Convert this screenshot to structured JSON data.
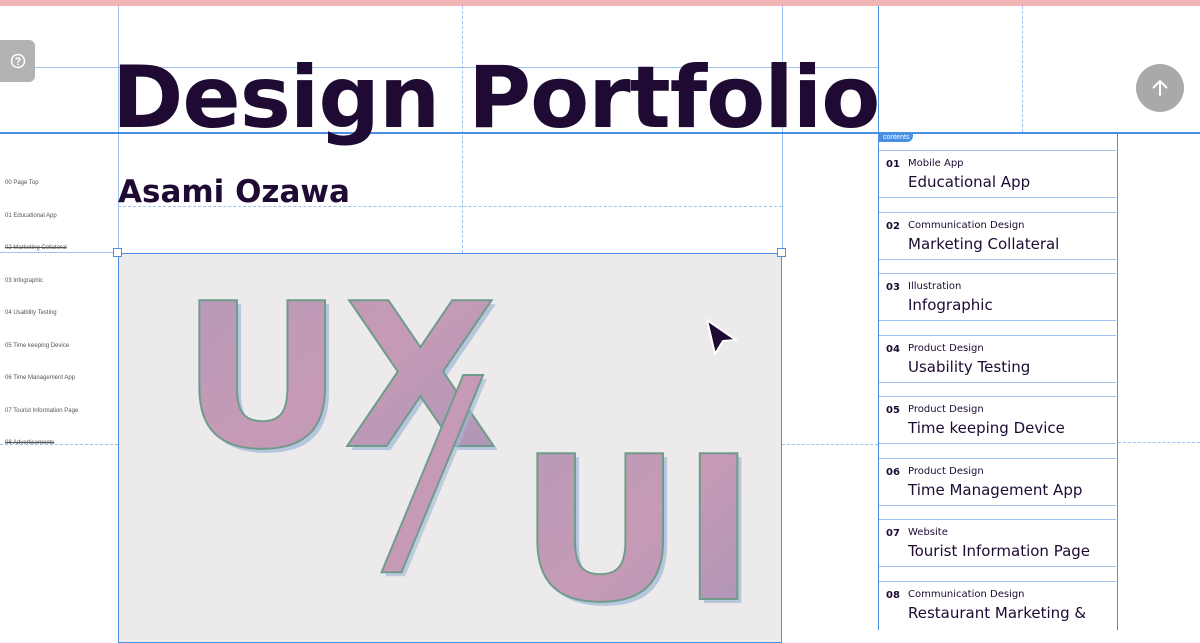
{
  "page": {
    "title": "Design Portfolio",
    "author": "Asami Ozawa",
    "accent_color": "#4a90e2",
    "text_color": "#1e0a33",
    "topbar_color": "#f0b4b4"
  },
  "controls": {
    "help_icon": "question-circle-icon",
    "scroll_top_icon": "arrow-up-icon"
  },
  "mini_nav": [
    "00 Page Top",
    "01 Educational App",
    "02 Marketing Collateral",
    "03 Infographic",
    "04 Usability Testing",
    "05 Time keeping Device",
    "06 Time Management App",
    "07 Tourist Information Page",
    "08 Advertisements"
  ],
  "hero": {
    "text_top": "UX",
    "text_slash": "/",
    "text_bottom": "UI"
  },
  "toc": {
    "tag": "contents",
    "items": [
      {
        "num": "01",
        "category": "Mobile App",
        "name": "Educational App"
      },
      {
        "num": "02",
        "category": "Communication Design",
        "name": "Marketing Collateral"
      },
      {
        "num": "03",
        "category": "Illustration",
        "name": "Infographic"
      },
      {
        "num": "04",
        "category": "Product Design",
        "name": "Usability Testing"
      },
      {
        "num": "05",
        "category": "Product Design",
        "name": "Time keeping Device"
      },
      {
        "num": "06",
        "category": "Product Design",
        "name": "Time Management App"
      },
      {
        "num": "07",
        "category": "Website",
        "name": "Tourist Information Page"
      },
      {
        "num": "08",
        "category": "Communication Design",
        "name": "Restaurant Marketing &"
      }
    ]
  }
}
